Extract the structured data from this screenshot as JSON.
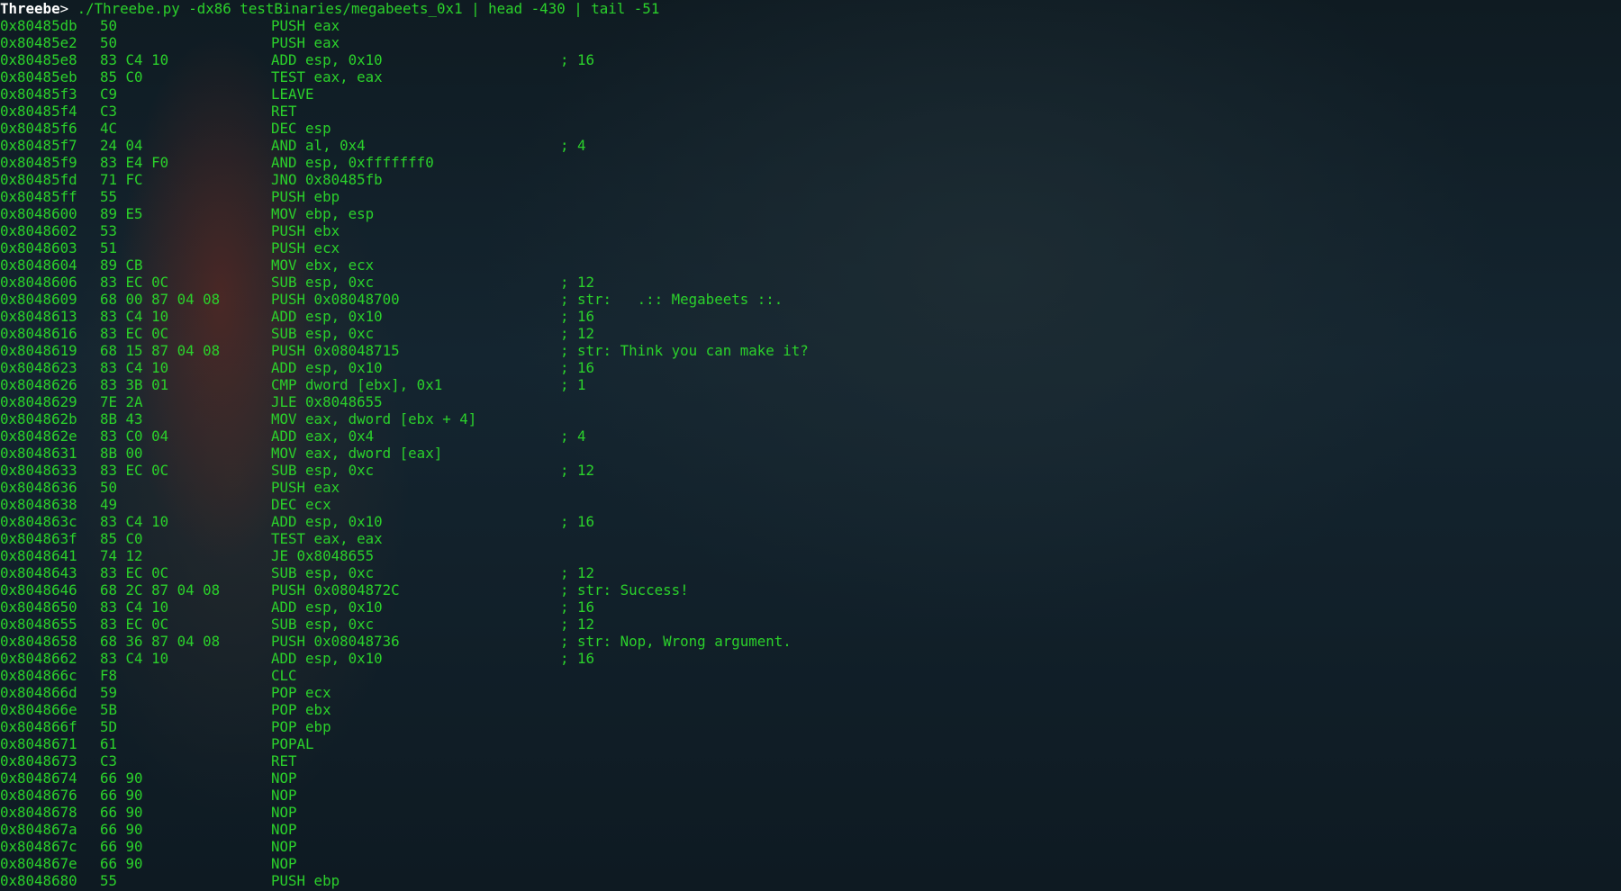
{
  "prompt": {
    "label": "Threebe",
    "symbol": "> ",
    "command": "./Threebe.py -dx86 testBinaries/megabeets_0x1 | head -430 | tail -51"
  },
  "rows": [
    {
      "addr": "0x80485db",
      "bytes": "50",
      "instr": "PUSH eax",
      "comment": ""
    },
    {
      "addr": "0x80485e2",
      "bytes": "50",
      "instr": "PUSH eax",
      "comment": ""
    },
    {
      "addr": "0x80485e8",
      "bytes": "83 C4 10",
      "instr": "ADD esp, 0x10",
      "comment": "; 16"
    },
    {
      "addr": "0x80485eb",
      "bytes": "85 C0",
      "instr": "TEST eax, eax",
      "comment": ""
    },
    {
      "addr": "0x80485f3",
      "bytes": "C9",
      "instr": "LEAVE",
      "comment": ""
    },
    {
      "addr": "0x80485f4",
      "bytes": "C3",
      "instr": "RET",
      "comment": ""
    },
    {
      "addr": "0x80485f6",
      "bytes": "4C",
      "instr": "DEC esp",
      "comment": ""
    },
    {
      "addr": "0x80485f7",
      "bytes": "24 04",
      "instr": "AND al, 0x4",
      "comment": "; 4"
    },
    {
      "addr": "0x80485f9",
      "bytes": "83 E4 F0",
      "instr": "AND esp, 0xfffffff0",
      "comment": ""
    },
    {
      "addr": "0x80485fd",
      "bytes": "71 FC",
      "instr": "JNO 0x80485fb",
      "comment": ""
    },
    {
      "addr": "0x80485ff",
      "bytes": "55",
      "instr": "PUSH ebp",
      "comment": ""
    },
    {
      "addr": "0x8048600",
      "bytes": "89 E5",
      "instr": "MOV ebp, esp",
      "comment": ""
    },
    {
      "addr": "0x8048602",
      "bytes": "53",
      "instr": "PUSH ebx",
      "comment": ""
    },
    {
      "addr": "0x8048603",
      "bytes": "51",
      "instr": "PUSH ecx",
      "comment": ""
    },
    {
      "addr": "0x8048604",
      "bytes": "89 CB",
      "instr": "MOV ebx, ecx",
      "comment": ""
    },
    {
      "addr": "0x8048606",
      "bytes": "83 EC 0C",
      "instr": "SUB esp, 0xc",
      "comment": "; 12"
    },
    {
      "addr": "0x8048609",
      "bytes": "68 00 87 04 08",
      "instr": "PUSH 0x08048700",
      "comment": "; str:   .:: Megabeets ::."
    },
    {
      "addr": "0x8048613",
      "bytes": "83 C4 10",
      "instr": "ADD esp, 0x10",
      "comment": "; 16"
    },
    {
      "addr": "0x8048616",
      "bytes": "83 EC 0C",
      "instr": "SUB esp, 0xc",
      "comment": "; 12"
    },
    {
      "addr": "0x8048619",
      "bytes": "68 15 87 04 08",
      "instr": "PUSH 0x08048715",
      "comment": "; str: Think you can make it?"
    },
    {
      "addr": "0x8048623",
      "bytes": "83 C4 10",
      "instr": "ADD esp, 0x10",
      "comment": "; 16"
    },
    {
      "addr": "0x8048626",
      "bytes": "83 3B 01",
      "instr": "CMP dword [ebx], 0x1",
      "comment": "; 1"
    },
    {
      "addr": "0x8048629",
      "bytes": "7E 2A",
      "instr": "JLE 0x8048655",
      "comment": ""
    },
    {
      "addr": "0x804862b",
      "bytes": "8B 43",
      "instr": "MOV eax, dword [ebx + 4]",
      "comment": ""
    },
    {
      "addr": "0x804862e",
      "bytes": "83 C0 04",
      "instr": "ADD eax, 0x4",
      "comment": "; 4"
    },
    {
      "addr": "0x8048631",
      "bytes": "8B 00",
      "instr": "MOV eax, dword [eax]",
      "comment": ""
    },
    {
      "addr": "0x8048633",
      "bytes": "83 EC 0C",
      "instr": "SUB esp, 0xc",
      "comment": "; 12"
    },
    {
      "addr": "0x8048636",
      "bytes": "50",
      "instr": "PUSH eax",
      "comment": ""
    },
    {
      "addr": "0x8048638",
      "bytes": "49",
      "instr": "DEC ecx",
      "comment": ""
    },
    {
      "addr": "0x804863c",
      "bytes": "83 C4 10",
      "instr": "ADD esp, 0x10",
      "comment": "; 16"
    },
    {
      "addr": "0x804863f",
      "bytes": "85 C0",
      "instr": "TEST eax, eax",
      "comment": ""
    },
    {
      "addr": "0x8048641",
      "bytes": "74 12",
      "instr": "JE 0x8048655",
      "comment": ""
    },
    {
      "addr": "0x8048643",
      "bytes": "83 EC 0C",
      "instr": "SUB esp, 0xc",
      "comment": "; 12"
    },
    {
      "addr": "0x8048646",
      "bytes": "68 2C 87 04 08",
      "instr": "PUSH 0x0804872C",
      "comment": "; str: Success!"
    },
    {
      "addr": "0x8048650",
      "bytes": "83 C4 10",
      "instr": "ADD esp, 0x10",
      "comment": "; 16"
    },
    {
      "addr": "0x8048655",
      "bytes": "83 EC 0C",
      "instr": "SUB esp, 0xc",
      "comment": "; 12"
    },
    {
      "addr": "0x8048658",
      "bytes": "68 36 87 04 08",
      "instr": "PUSH 0x08048736",
      "comment": "; str: Nop, Wrong argument."
    },
    {
      "addr": "0x8048662",
      "bytes": "83 C4 10",
      "instr": "ADD esp, 0x10",
      "comment": "; 16"
    },
    {
      "addr": "0x804866c",
      "bytes": "F8",
      "instr": "CLC",
      "comment": ""
    },
    {
      "addr": "0x804866d",
      "bytes": "59",
      "instr": "POP ecx",
      "comment": ""
    },
    {
      "addr": "0x804866e",
      "bytes": "5B",
      "instr": "POP ebx",
      "comment": ""
    },
    {
      "addr": "0x804866f",
      "bytes": "5D",
      "instr": "POP ebp",
      "comment": ""
    },
    {
      "addr": "0x8048671",
      "bytes": "61",
      "instr": "POPAL",
      "comment": ""
    },
    {
      "addr": "0x8048673",
      "bytes": "C3",
      "instr": "RET",
      "comment": ""
    },
    {
      "addr": "0x8048674",
      "bytes": "66 90",
      "instr": "NOP",
      "comment": ""
    },
    {
      "addr": "0x8048676",
      "bytes": "66 90",
      "instr": "NOP",
      "comment": ""
    },
    {
      "addr": "0x8048678",
      "bytes": "66 90",
      "instr": "NOP",
      "comment": ""
    },
    {
      "addr": "0x804867a",
      "bytes": "66 90",
      "instr": "NOP",
      "comment": ""
    },
    {
      "addr": "0x804867c",
      "bytes": "66 90",
      "instr": "NOP",
      "comment": ""
    },
    {
      "addr": "0x804867e",
      "bytes": "66 90",
      "instr": "NOP",
      "comment": ""
    },
    {
      "addr": "0x8048680",
      "bytes": "55",
      "instr": "PUSH ebp",
      "comment": ""
    }
  ]
}
